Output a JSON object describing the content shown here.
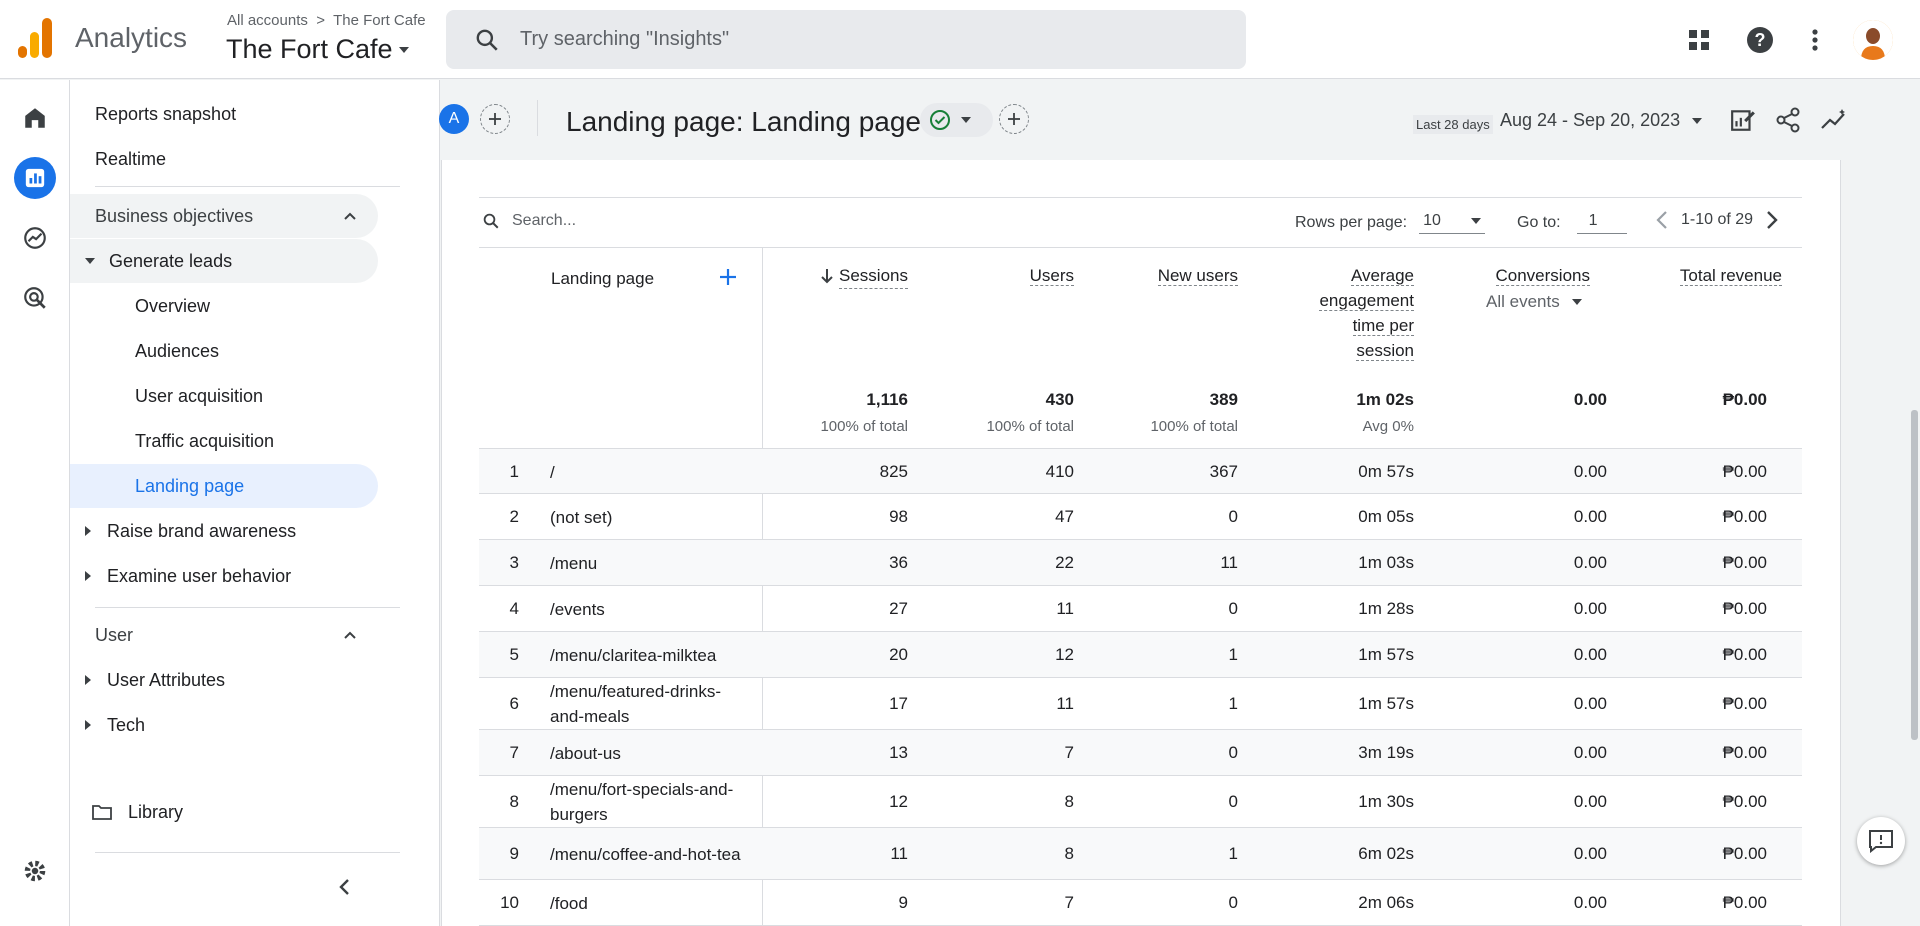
{
  "app": {
    "name": "Analytics",
    "breadcrumb_all": "All accounts",
    "breadcrumb_property": "The Fort Cafe",
    "property": "The Fort Cafe"
  },
  "search": {
    "placeholder": "Try searching \"Insights\""
  },
  "sidebar": {
    "items": [
      {
        "label": "Reports snapshot"
      },
      {
        "label": "Realtime"
      },
      {
        "label": "Business objectives"
      },
      {
        "label": "Generate leads"
      },
      {
        "label": "Overview"
      },
      {
        "label": "Audiences"
      },
      {
        "label": "User acquisition"
      },
      {
        "label": "Traffic acquisition"
      },
      {
        "label": "Landing page"
      },
      {
        "label": "Raise brand awareness"
      },
      {
        "label": "Examine user behavior"
      },
      {
        "label": "User"
      },
      {
        "label": "User Attributes"
      },
      {
        "label": "Tech"
      },
      {
        "label": "Library"
      }
    ]
  },
  "header": {
    "compare_letter": "A",
    "title": "Landing page: Landing page",
    "date_label": "Last 28 days",
    "date_range": "Aug 24 - Sep 20, 2023"
  },
  "table": {
    "search_placeholder": "Search...",
    "rows_per_page_label": "Rows per page:",
    "rows_per_page": "10",
    "goto_label": "Go to:",
    "goto_value": "1",
    "range": "1-10 of 29",
    "dimension_header": "Landing page",
    "headers": {
      "sessions": "Sessions",
      "users": "Users",
      "new_users": "New users",
      "aet_1": "Average",
      "aet_2": "engagement",
      "aet_3": "time per",
      "aet_4": "session",
      "conversions": "Conversions",
      "conversions_sub": "All events",
      "revenue": "Total revenue"
    },
    "totals": {
      "sessions": "1,116",
      "sessions_pct": "100% of total",
      "users": "430",
      "users_pct": "100% of total",
      "new_users": "389",
      "new_users_pct": "100% of total",
      "aet": "1m 02s",
      "aet_avg": "Avg 0%",
      "conversions": "0.00",
      "revenue": "₱0.00"
    },
    "rows": [
      {
        "n": "1",
        "page": "/",
        "sessions": "825",
        "users": "410",
        "new_users": "367",
        "aet": "0m 57s",
        "conv": "0.00",
        "rev": "₱0.00"
      },
      {
        "n": "2",
        "page": "(not set)",
        "sessions": "98",
        "users": "47",
        "new_users": "0",
        "aet": "0m 05s",
        "conv": "0.00",
        "rev": "₱0.00"
      },
      {
        "n": "3",
        "page": "/menu",
        "sessions": "36",
        "users": "22",
        "new_users": "11",
        "aet": "1m 03s",
        "conv": "0.00",
        "rev": "₱0.00"
      },
      {
        "n": "4",
        "page": "/events",
        "sessions": "27",
        "users": "11",
        "new_users": "0",
        "aet": "1m 28s",
        "conv": "0.00",
        "rev": "₱0.00"
      },
      {
        "n": "5",
        "page": "/menu/claritea-milktea",
        "sessions": "20",
        "users": "12",
        "new_users": "1",
        "aet": "1m 57s",
        "conv": "0.00",
        "rev": "₱0.00"
      },
      {
        "n": "6",
        "page": "/menu/featured-drinks-and-meals",
        "sessions": "17",
        "users": "11",
        "new_users": "1",
        "aet": "1m 57s",
        "conv": "0.00",
        "rev": "₱0.00"
      },
      {
        "n": "7",
        "page": "/about-us",
        "sessions": "13",
        "users": "7",
        "new_users": "0",
        "aet": "3m 19s",
        "conv": "0.00",
        "rev": "₱0.00"
      },
      {
        "n": "8",
        "page": "/menu/fort-specials-and-burgers",
        "sessions": "12",
        "users": "8",
        "new_users": "0",
        "aet": "1m 30s",
        "conv": "0.00",
        "rev": "₱0.00"
      },
      {
        "n": "9",
        "page": "/menu/coffee-and-hot-tea",
        "sessions": "11",
        "users": "8",
        "new_users": "1",
        "aet": "6m 02s",
        "conv": "0.00",
        "rev": "₱0.00"
      },
      {
        "n": "10",
        "page": "/food",
        "sessions": "9",
        "users": "7",
        "new_users": "0",
        "aet": "2m 06s",
        "conv": "0.00",
        "rev": "₱0.00"
      }
    ]
  },
  "colors": {
    "accent": "#1a73e8",
    "logo_orange": "#f9ab00",
    "logo_dark_orange": "#e37400"
  }
}
